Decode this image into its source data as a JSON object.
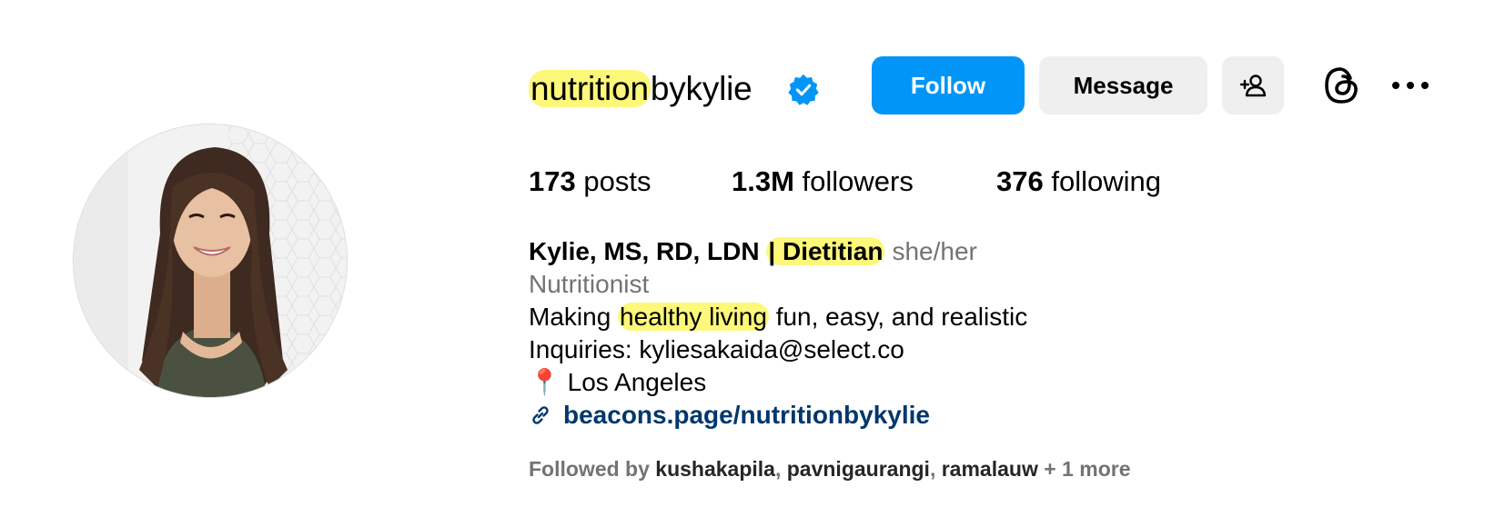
{
  "profile": {
    "username_part1": "nutrition",
    "username_part2": "bykylie",
    "verified_icon": "verified-badge-icon",
    "buttons": {
      "follow": "Follow",
      "message": "Message"
    },
    "stats": {
      "posts_count": "173",
      "posts_label": "posts",
      "followers_count": "1.3M",
      "followers_label": "followers",
      "following_count": "376",
      "following_label": "following"
    },
    "bio": {
      "name_part1": "Kylie, MS, RD, LDN",
      "name_part2": "| Dietitian",
      "pronouns": "she/her",
      "category": "Nutritionist",
      "line1_part1": "Making",
      "line1_part2": "healthy living",
      "line1_part3": "fun, easy, and realistic",
      "line2": "Inquiries: kyliesakaida@select.co",
      "location_pin": "📍",
      "location": "Los Angeles",
      "link": "beacons.page/nutritionbykylie"
    },
    "followed_by": {
      "prefix": "Followed by",
      "users": [
        "kushakapila",
        "pavnigaurangi",
        "ramalauw"
      ],
      "suffix": "+ 1 more"
    }
  },
  "colors": {
    "accent": "#0095f6",
    "highlight": "#fdf77a",
    "link": "#00376b",
    "secondary_text": "#737373"
  }
}
